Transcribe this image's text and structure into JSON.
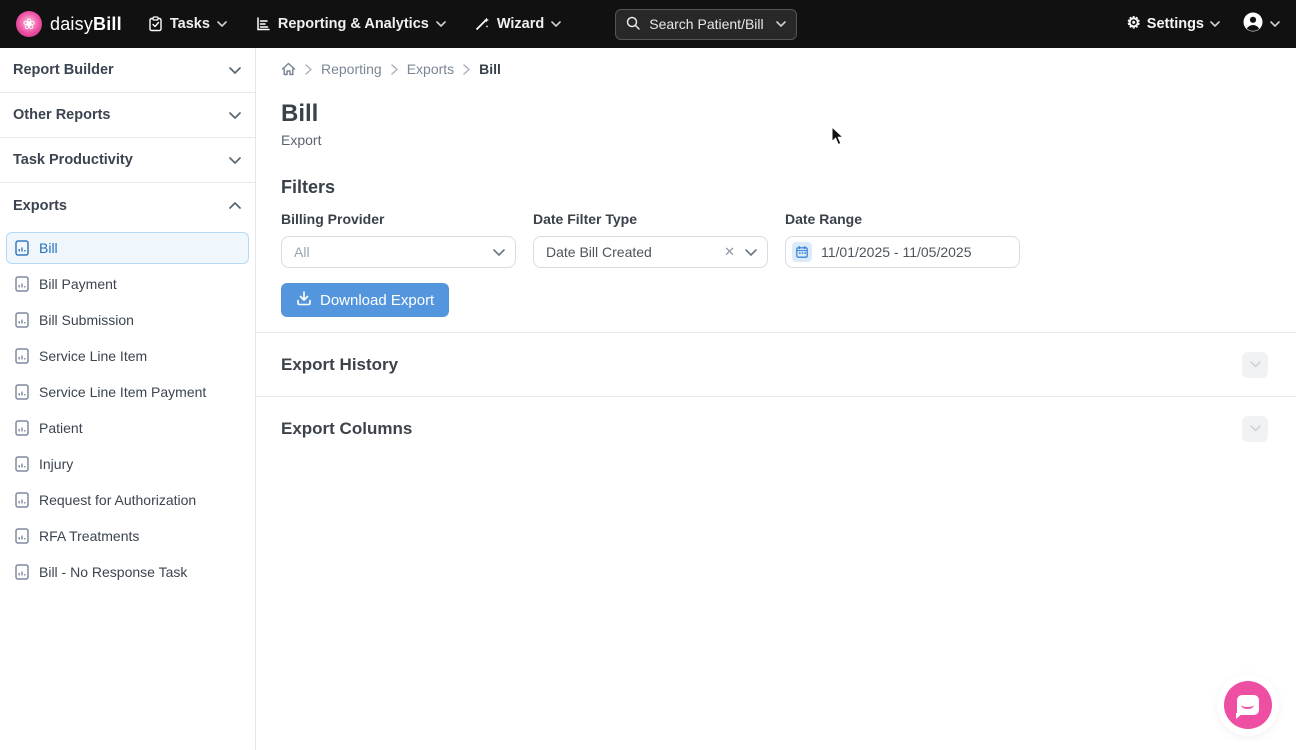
{
  "navbar": {
    "brand_daisy": "daisy",
    "brand_bill": "Bill",
    "menu": [
      {
        "label": "Tasks"
      },
      {
        "label": "Reporting & Analytics"
      },
      {
        "label": "Wizard"
      }
    ],
    "search_placeholder": "Search Patient/Bill",
    "settings_label": "Settings"
  },
  "sidebar": {
    "sections": [
      {
        "label": "Report Builder"
      },
      {
        "label": "Other Reports"
      },
      {
        "label": "Task Productivity"
      },
      {
        "label": "Exports"
      }
    ],
    "export_items": [
      {
        "label": "Bill"
      },
      {
        "label": "Bill Payment"
      },
      {
        "label": "Bill Submission"
      },
      {
        "label": "Service Line Item"
      },
      {
        "label": "Service Line Item Payment"
      },
      {
        "label": "Patient"
      },
      {
        "label": "Injury"
      },
      {
        "label": "Request for Authorization"
      },
      {
        "label": "RFA Treatments"
      },
      {
        "label": "Bill - No Response Task"
      }
    ]
  },
  "breadcrumb": {
    "items": [
      {
        "label": "Reporting"
      },
      {
        "label": "Exports"
      },
      {
        "label": "Bill"
      }
    ]
  },
  "page": {
    "title": "Bill",
    "subtitle": "Export"
  },
  "filters": {
    "heading": "Filters",
    "billing_provider_label": "Billing Provider",
    "billing_provider_value": "All",
    "date_filter_type_label": "Date Filter Type",
    "date_filter_type_value": "Date Bill Created",
    "date_range_label": "Date Range",
    "date_range_value": "11/01/2025 - 11/05/2025",
    "download_button_label": "Download Export"
  },
  "panels": [
    {
      "title": "Export History"
    },
    {
      "title": "Export Columns"
    }
  ],
  "colors": {
    "navbar_bg": "#111111",
    "accent_blue": "#5496dd",
    "selected_item_bg": "#eff7fd",
    "selected_item_border": "#b7d8f3",
    "selected_item_text": "#2471b8",
    "brand_pink": "#ee4fa2"
  }
}
